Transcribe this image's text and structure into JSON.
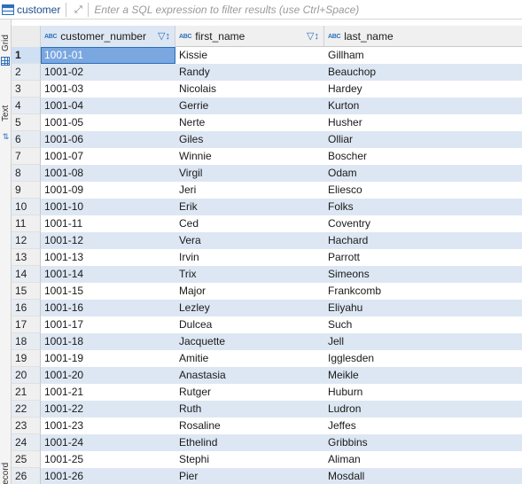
{
  "toolbar": {
    "table_name": "customer",
    "filter_placeholder": "Enter a SQL expression to filter results (use Ctrl+Space)"
  },
  "side_tabs": {
    "grid_label": "Grid",
    "text_label": "Text",
    "record_label": "Record"
  },
  "columns": [
    {
      "type_badge": "ABC",
      "label": "customer_number",
      "has_sort_filter": true
    },
    {
      "type_badge": "ABC",
      "label": "first_name",
      "has_sort_filter": true
    },
    {
      "type_badge": "ABC",
      "label": "last_name",
      "has_sort_filter": false
    }
  ],
  "rows": [
    {
      "n": "1",
      "customer_number": "1001-01",
      "first_name": "Kissie",
      "last_name": "Gillham"
    },
    {
      "n": "2",
      "customer_number": "1001-02",
      "first_name": "Randy",
      "last_name": "Beauchop"
    },
    {
      "n": "3",
      "customer_number": "1001-03",
      "first_name": "Nicolais",
      "last_name": "Hardey"
    },
    {
      "n": "4",
      "customer_number": "1001-04",
      "first_name": "Gerrie",
      "last_name": "Kurton"
    },
    {
      "n": "5",
      "customer_number": "1001-05",
      "first_name": "Nerte",
      "last_name": "Husher"
    },
    {
      "n": "6",
      "customer_number": "1001-06",
      "first_name": "Giles",
      "last_name": "Olliar"
    },
    {
      "n": "7",
      "customer_number": "1001-07",
      "first_name": "Winnie",
      "last_name": "Boscher"
    },
    {
      "n": "8",
      "customer_number": "1001-08",
      "first_name": "Virgil",
      "last_name": "Odam"
    },
    {
      "n": "9",
      "customer_number": "1001-09",
      "first_name": "Jeri",
      "last_name": "Eliesco"
    },
    {
      "n": "10",
      "customer_number": "1001-10",
      "first_name": "Erik",
      "last_name": "Folks"
    },
    {
      "n": "11",
      "customer_number": "1001-11",
      "first_name": "Ced",
      "last_name": "Coventry"
    },
    {
      "n": "12",
      "customer_number": "1001-12",
      "first_name": "Vera",
      "last_name": "Hachard"
    },
    {
      "n": "13",
      "customer_number": "1001-13",
      "first_name": "Irvin",
      "last_name": "Parrott"
    },
    {
      "n": "14",
      "customer_number": "1001-14",
      "first_name": "Trix",
      "last_name": "Simeons"
    },
    {
      "n": "15",
      "customer_number": "1001-15",
      "first_name": "Major",
      "last_name": "Frankcomb"
    },
    {
      "n": "16",
      "customer_number": "1001-16",
      "first_name": "Lezley",
      "last_name": "Eliyahu"
    },
    {
      "n": "17",
      "customer_number": "1001-17",
      "first_name": "Dulcea",
      "last_name": "Such"
    },
    {
      "n": "18",
      "customer_number": "1001-18",
      "first_name": "Jacquette",
      "last_name": "Jell"
    },
    {
      "n": "19",
      "customer_number": "1001-19",
      "first_name": "Amitie",
      "last_name": "Igglesden"
    },
    {
      "n": "20",
      "customer_number": "1001-20",
      "first_name": "Anastasia",
      "last_name": "Meikle"
    },
    {
      "n": "21",
      "customer_number": "1001-21",
      "first_name": "Rutger",
      "last_name": "Huburn"
    },
    {
      "n": "22",
      "customer_number": "1001-22",
      "first_name": "Ruth",
      "last_name": "Ludron"
    },
    {
      "n": "23",
      "customer_number": "1001-23",
      "first_name": "Rosaline",
      "last_name": "Jeffes"
    },
    {
      "n": "24",
      "customer_number": "1001-24",
      "first_name": "Ethelind",
      "last_name": "Gribbins"
    },
    {
      "n": "25",
      "customer_number": "1001-25",
      "first_name": "Stephi",
      "last_name": "Aliman"
    },
    {
      "n": "26",
      "customer_number": "1001-26",
      "first_name": "Pier",
      "last_name": "Mosdall"
    }
  ],
  "colors": {
    "accent": "#2c6fb7",
    "alt_row": "#dde7f3",
    "selected_cell": "#7aa7e0"
  },
  "icons": {
    "table": "table-icon",
    "expand": "expand-icon",
    "sort_filter": "sort-filter-icon",
    "grid_view": "grid-icon",
    "switch_view": "switch-icon",
    "record": "record-icon"
  }
}
